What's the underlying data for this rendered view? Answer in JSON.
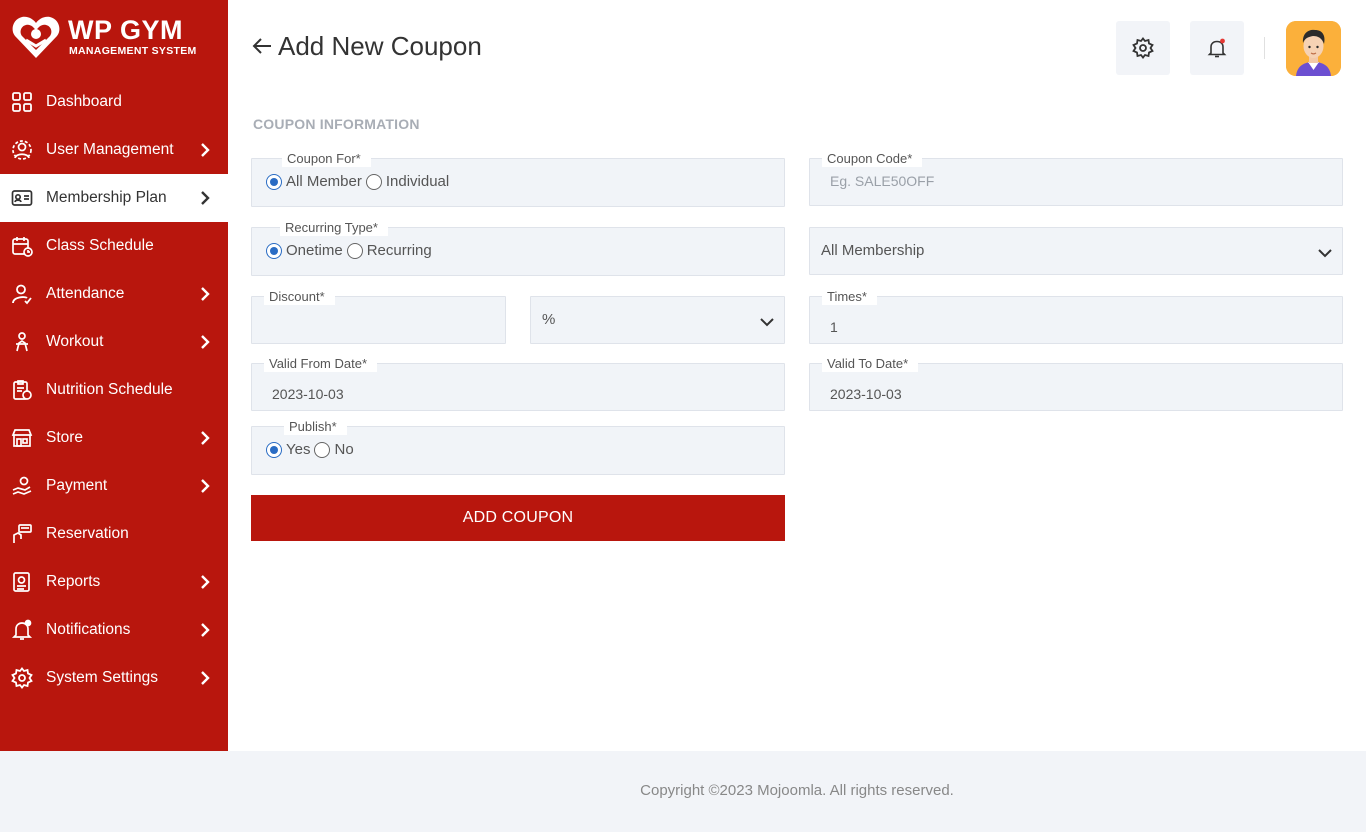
{
  "brand": {
    "title": "WP GYM",
    "subtitle": "MANAGEMENT SYSTEM"
  },
  "sidebar": {
    "items": [
      {
        "label": "Dashboard",
        "icon": "dashboard-grid-icon",
        "has_submenu": false,
        "active": false
      },
      {
        "label": "User Management",
        "icon": "users-gear-icon",
        "has_submenu": true,
        "active": false
      },
      {
        "label": "Membership Plan",
        "icon": "membership-card-icon",
        "has_submenu": true,
        "active": true
      },
      {
        "label": "Class Schedule",
        "icon": "calendar-icon",
        "has_submenu": false,
        "active": false
      },
      {
        "label": "Attendance",
        "icon": "user-check-icon",
        "has_submenu": true,
        "active": false
      },
      {
        "label": "Workout",
        "icon": "workout-icon",
        "has_submenu": true,
        "active": false
      },
      {
        "label": "Nutrition Schedule",
        "icon": "nutrition-clipboard-icon",
        "has_submenu": false,
        "active": false
      },
      {
        "label": "Store",
        "icon": "store-icon",
        "has_submenu": true,
        "active": false
      },
      {
        "label": "Payment",
        "icon": "payment-hand-icon",
        "has_submenu": true,
        "active": false
      },
      {
        "label": "Reservation",
        "icon": "reservation-icon",
        "has_submenu": false,
        "active": false
      },
      {
        "label": "Reports",
        "icon": "reports-icon",
        "has_submenu": true,
        "active": false
      },
      {
        "label": "Notifications",
        "icon": "bell-icon",
        "has_submenu": true,
        "active": false
      },
      {
        "label": "System Settings",
        "icon": "gear-icon",
        "has_submenu": true,
        "active": false
      }
    ]
  },
  "header": {
    "title": "Add New Coupon"
  },
  "form": {
    "section_title": "COUPON INFORMATION",
    "coupon_for": {
      "label": "Coupon For*",
      "options": [
        "All Member",
        "Individual"
      ],
      "selected": "All Member"
    },
    "coupon_code": {
      "label": "Coupon Code*",
      "placeholder": "Eg. SALE50OFF",
      "value": ""
    },
    "recurring_type": {
      "label": "Recurring Type*",
      "options": [
        "Onetime",
        "Recurring"
      ],
      "selected": "Onetime"
    },
    "membership_select": {
      "value": "All Membership"
    },
    "discount": {
      "label": "Discount*",
      "value": ""
    },
    "discount_type": {
      "value": "%"
    },
    "times": {
      "label": "Times*",
      "value": "1"
    },
    "valid_from": {
      "label": "Valid From Date*",
      "value": "2023-10-03"
    },
    "valid_to": {
      "label": "Valid To Date*",
      "value": "2023-10-03"
    },
    "publish": {
      "label": "Publish*",
      "options": [
        "Yes",
        "No"
      ],
      "selected": "Yes"
    },
    "submit_label": "ADD COUPON"
  },
  "footer": {
    "copyright": "Copyright ©2023 Mojoomla. All rights reserved."
  },
  "colors": {
    "brand_red": "#b8160d",
    "field_bg": "#f1f4f8",
    "radio_accent": "#2a6cc4",
    "notification_dot": "#e53935"
  }
}
